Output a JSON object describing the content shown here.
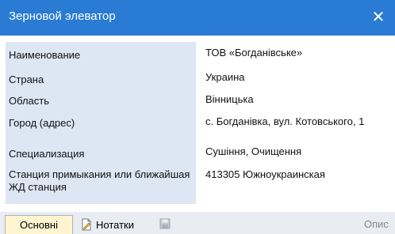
{
  "window": {
    "title": "Зерновой элеватор"
  },
  "icons": {
    "close": "close-icon",
    "notes": "note-icon",
    "save": "save-icon"
  },
  "properties": [
    {
      "label": "Наименование",
      "value": "ТОВ «Богданівське»"
    },
    {
      "label": "Страна",
      "value": "Украина"
    },
    {
      "label": "Область",
      "value": "Вінницька"
    },
    {
      "label": "Город (адрес)",
      "value": "с. Богданівка, вул. Котовського, 1"
    },
    {
      "label": "Специализация",
      "value": "Сушіння, Очищення"
    },
    {
      "label": "Станция примыкания или ближайшая ЖД станция",
      "value": "413305 Южноукраинская"
    }
  ],
  "toolbar": {
    "tab_main": "Основні",
    "tab_notes": "Нотатки",
    "desc_label": "Опис"
  },
  "colors": {
    "titlebar": "#2a7bd3",
    "label_bg": "#dde6f3",
    "active_tab": "#fff6d1"
  }
}
